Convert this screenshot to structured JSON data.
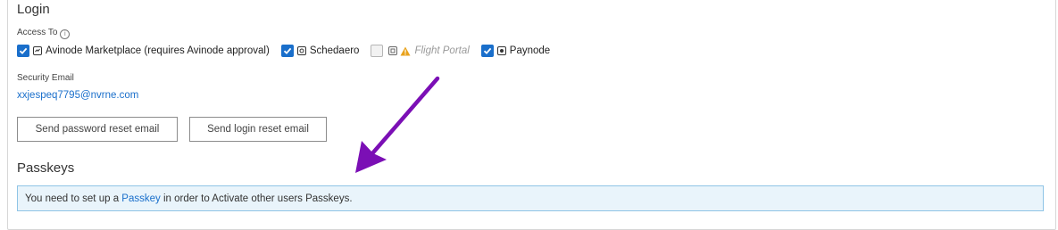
{
  "login": {
    "title": "Login",
    "access_label": "Access To",
    "info_glyph": "i",
    "access_items": [
      {
        "label": "Avinode Marketplace (requires Avinode approval)",
        "checked": true,
        "disabled": false
      },
      {
        "label": "Schedaero",
        "checked": true,
        "disabled": false
      },
      {
        "label": "Flight Portal",
        "checked": false,
        "disabled": true
      },
      {
        "label": "Paynode",
        "checked": true,
        "disabled": false
      }
    ],
    "security_email_label": "Security Email",
    "security_email": "xxjespeq7795@nvrne.com",
    "buttons": {
      "password_reset": "Send password reset email",
      "login_reset": "Send login reset email"
    }
  },
  "passkeys": {
    "title": "Passkeys",
    "notice_prefix": "You need to set up a ",
    "notice_link": "Passkey",
    "notice_suffix": " in order to Activate other users Passkeys."
  },
  "colors": {
    "accent": "#1a6fcb",
    "annotation_arrow": "#7b0fb5",
    "notice_bg": "#e9f4fb",
    "notice_border": "#8fc4e6"
  }
}
